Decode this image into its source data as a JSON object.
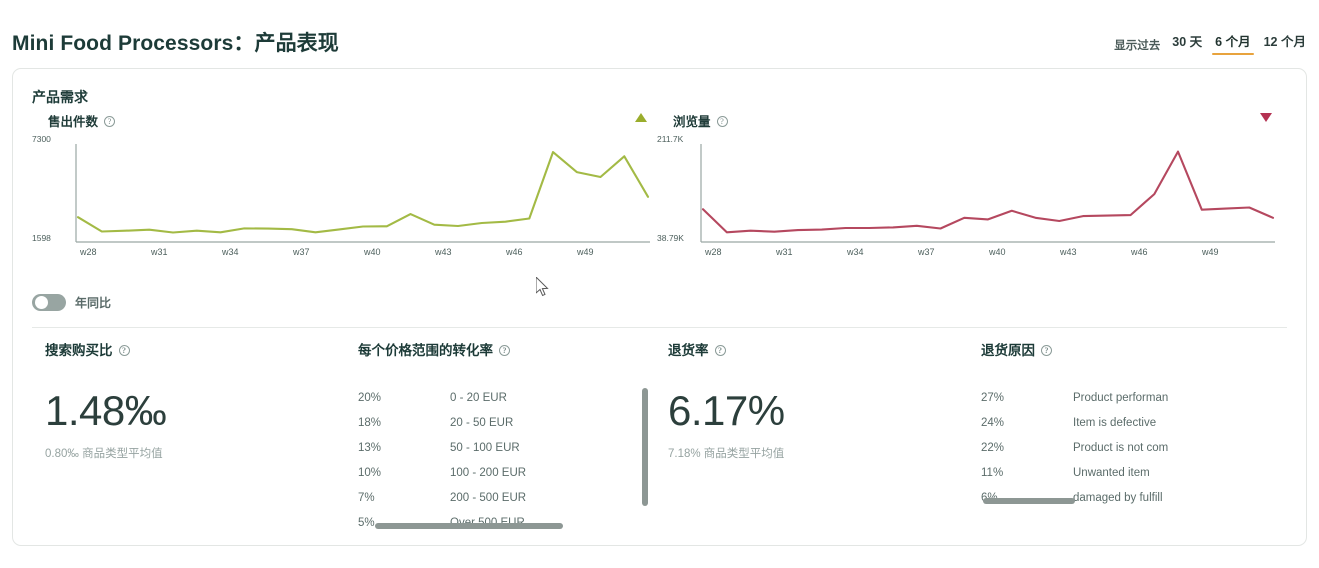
{
  "header": {
    "title_en": "Mini Food Processors",
    "title_sep": "：",
    "title_cn": "产品表现",
    "range_label": "显示过去",
    "range_options": [
      {
        "label": "30 天",
        "active": false
      },
      {
        "label": "6 个月",
        "active": true
      },
      {
        "label": "12 个月",
        "active": false
      }
    ],
    "accent_color": "#e8a33d"
  },
  "demand": {
    "section_title": "产品需求",
    "toggle_label": "年同比",
    "toggle_on": false,
    "units_sold": {
      "metric_name": "售出件数",
      "info_icon": "info-circle-icon",
      "trend_icon": "triangle-up-icon",
      "trend_color": "#9aad2c"
    },
    "page_views": {
      "metric_name": "浏览量",
      "info_icon": "info-circle-icon",
      "trend_icon": "triangle-down-icon",
      "trend_color": "#b43252"
    }
  },
  "metrics": {
    "search_buy_ratio": {
      "title": "搜索购买比",
      "info_icon": "info-circle-icon",
      "value": "1.48‰",
      "subtext": "0.80‰ 商品类型平均值"
    },
    "conversion_by_price": {
      "title": "每个价格范围的转化率",
      "info_icon": "info-circle-icon",
      "rows": [
        {
          "pct": "20%",
          "label": "0 - 20 EUR"
        },
        {
          "pct": "18%",
          "label": "20 - 50 EUR"
        },
        {
          "pct": "13%",
          "label": "50 - 100 EUR"
        },
        {
          "pct": "10%",
          "label": "100 - 200 EUR"
        },
        {
          "pct": "7%",
          "label": "200 - 500 EUR"
        },
        {
          "pct": "5%",
          "label": "Over 500 EUR"
        }
      ]
    },
    "return_rate": {
      "title": "退货率",
      "info_icon": "info-circle-icon",
      "value": "6.17%",
      "subtext": "7.18% 商品类型平均值"
    },
    "return_reasons": {
      "title": "退货原因",
      "info_icon": "info-circle-icon",
      "rows": [
        {
          "pct": "27%",
          "label": "Product performan"
        },
        {
          "pct": "24%",
          "label": "Item is defective"
        },
        {
          "pct": "22%",
          "label": "Product is not com"
        },
        {
          "pct": "11%",
          "label": "Unwanted item"
        },
        {
          "pct": "6%",
          "label": "damaged by fulfill"
        }
      ]
    }
  },
  "chart_data": [
    {
      "type": "line",
      "title": "售出件数",
      "xlabel": "",
      "ylabel": "",
      "line_color": "#a3ba45",
      "ylim": [
        1598,
        7300
      ],
      "ytick_labels": [
        "7300",
        "1598"
      ],
      "xtick_labels": [
        "w28",
        "w31",
        "w34",
        "w37",
        "w40",
        "w43",
        "w46",
        "w49"
      ],
      "x": [
        "w28",
        "w29",
        "w30",
        "w31",
        "w32",
        "w33",
        "w34",
        "w35",
        "w36",
        "w37",
        "w38",
        "w39",
        "w40",
        "w41",
        "w42",
        "w43",
        "w44",
        "w45",
        "w46",
        "w47",
        "w48",
        "w49",
        "w50",
        "w51",
        "w52"
      ],
      "values": [
        3060,
        2180,
        2230,
        2290,
        2120,
        2230,
        2130,
        2370,
        2360,
        2320,
        2130,
        2310,
        2490,
        2500,
        3250,
        2600,
        2520,
        2700,
        2780,
        2980,
        7050,
        5820,
        5520,
        6790,
        4310
      ],
      "grid": false,
      "legend": false
    },
    {
      "type": "line",
      "title": "浏览量",
      "xlabel": "",
      "ylabel": "",
      "line_color": "#b5485f",
      "ylim": [
        38790,
        211700
      ],
      "ytick_labels": [
        "211.7K",
        "38.79K"
      ],
      "xtick_labels": [
        "w28",
        "w31",
        "w34",
        "w37",
        "w40",
        "w43",
        "w46",
        "w49"
      ],
      "x": [
        "w28",
        "w29",
        "w30",
        "w31",
        "w32",
        "w33",
        "w34",
        "w35",
        "w36",
        "w37",
        "w38",
        "w39",
        "w40",
        "w41",
        "w42",
        "w43",
        "w44",
        "w45",
        "w46",
        "w47",
        "w48",
        "w49",
        "w50",
        "w51",
        "w52"
      ],
      "values": [
        98000,
        55000,
        58000,
        56000,
        59000,
        60000,
        63000,
        63000,
        64000,
        67000,
        62000,
        82000,
        79000,
        95000,
        82000,
        76000,
        85000,
        86000,
        87000,
        126000,
        205000,
        97000,
        99000,
        101000,
        82000
      ],
      "grid": false,
      "legend": false
    }
  ]
}
